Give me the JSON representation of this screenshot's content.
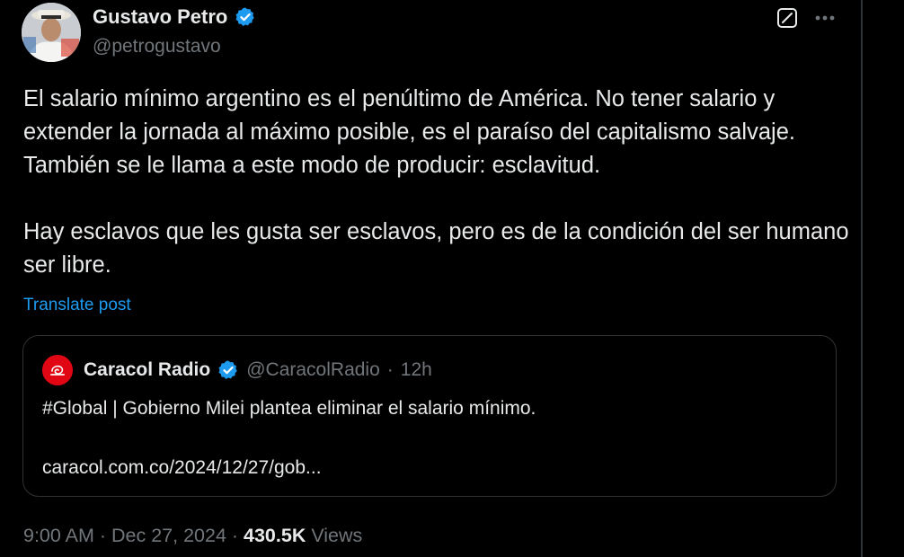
{
  "author": {
    "name": "Gustavo Petro",
    "handle": "@petrogustavo"
  },
  "icons": {
    "verified": "verified-badge-icon",
    "grok": "grok-icon",
    "more": "more-options-icon",
    "quote_avatar": "caracol-radio-logo"
  },
  "colors": {
    "background": "#000000",
    "text": "#e7e9ea",
    "secondary_text": "#71767b",
    "link": "#1d9bf0",
    "verified": "#1d9bf0",
    "border": "#2f3336",
    "caracol_red": "#e10613"
  },
  "tweet": {
    "paragraph1": "El salario mínimo argentino es el penúltimo de América. No tener salario y extender la jornada al máximo posible, es el paraíso del capitalismo salvaje. También se le llama a este modo de producir: esclavitud.",
    "paragraph2": "Hay esclavos que les gusta ser esclavos, pero es de la condición del ser humano ser libre.",
    "translate_label": "Translate post"
  },
  "quote": {
    "name": "Caracol Radio",
    "handle": "@CaracolRadio",
    "separator": "·",
    "time": "12h",
    "text": "#Global | Gobierno Milei plantea eliminar el salario mínimo.",
    "link": "caracol.com.co/2024/12/27/gob..."
  },
  "meta": {
    "time": "9:00 AM",
    "separator": " · ",
    "date": "Dec 27, 2024",
    "views_count": "430.5K",
    "views_label": " Views"
  }
}
